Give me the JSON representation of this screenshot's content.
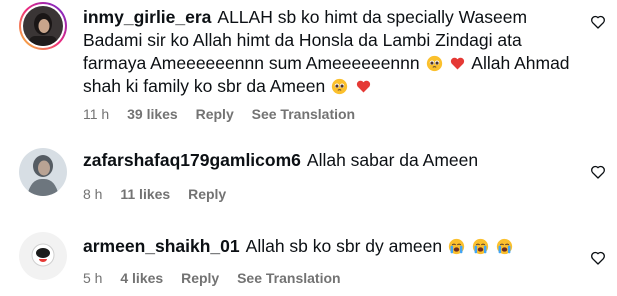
{
  "comments": [
    {
      "username": "inmy_girlie_era",
      "text_parts": [
        "ALLAH sb ko himt da specially Waseem Badami sir ko Allah himt da Honsla da Lambi Zindagi ata farmaya Ameeeeeennn sum Ameeeeeennn",
        "Allah Ahmad shah ki family ko sbr da Ameen"
      ],
      "time": "11 h",
      "likes": "39 likes",
      "reply": "Reply",
      "translation": "See Translation"
    },
    {
      "username": "zafarshafaq179gamlicom6",
      "text": "Allah sabar da Ameen",
      "time": "8 h",
      "likes": "11 likes",
      "reply": "Reply"
    },
    {
      "username": "armeen_shaikh_01",
      "text": "Allah sb ko sbr dy ameen",
      "time": "5 h",
      "likes": "4 likes",
      "reply": "Reply",
      "translation": "See Translation"
    }
  ],
  "icons": {
    "like": "heart-outline-icon",
    "pleading_face": "pleading-face-emoji",
    "red_heart": "red-heart-emoji",
    "crying_face": "loudly-crying-face-emoji"
  },
  "colors": {
    "text": "#0c1014",
    "secondary": "#737373",
    "heart_red": "#ff3040"
  }
}
